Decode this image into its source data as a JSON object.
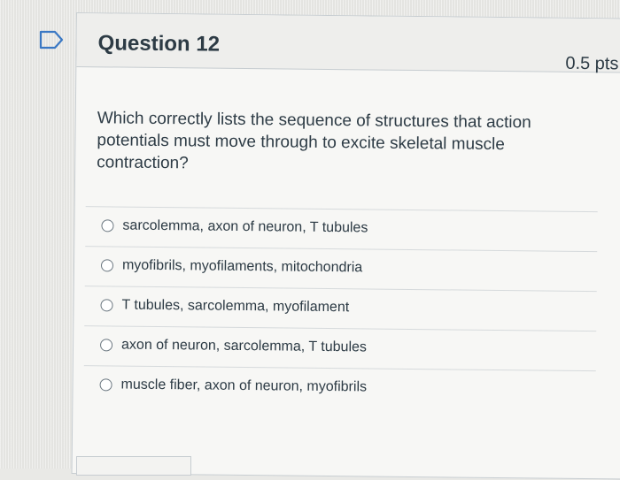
{
  "question": {
    "title": "Question 12",
    "points": "0.5 pts",
    "text": "Which correctly lists the sequence of structures that action potentials must move through to excite skeletal muscle contraction?",
    "answers": [
      {
        "label": "sarcolemma, axon of neuron, T tubules"
      },
      {
        "label": "myofibrils, myofilaments, mitochondria"
      },
      {
        "label": "T tubules, sarcolemma, myofilament"
      },
      {
        "label": "axon of neuron, sarcolemma, T tubules"
      },
      {
        "label": "muscle fiber, axon of neuron, myofibrils"
      }
    ]
  },
  "icons": {
    "flag": "flag-question-icon",
    "radio": "radio-button-icon"
  },
  "colors": {
    "text": "#2d3b45",
    "border": "#c7cdd1",
    "flag": "#3a78c4"
  }
}
